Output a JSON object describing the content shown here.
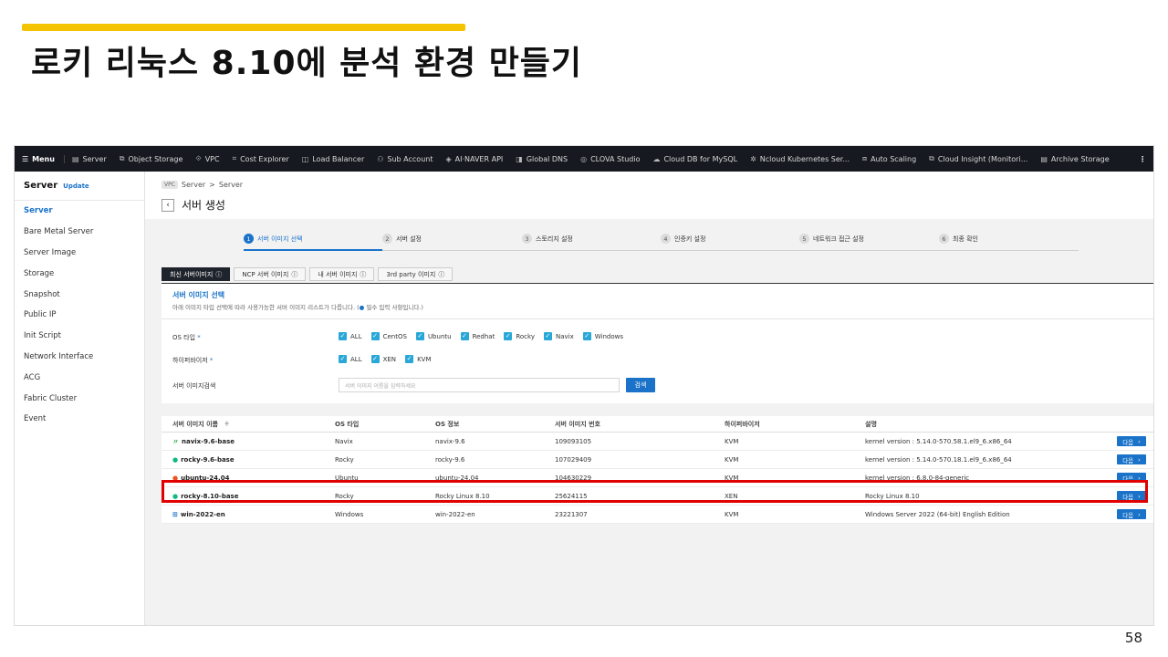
{
  "slide": {
    "title": "로키 리눅스 8.10에 분석 환경 만들기",
    "page_number": "58"
  },
  "topnav": {
    "menu_label": "Menu",
    "items": [
      {
        "label": "Server",
        "icon": "server-icon"
      },
      {
        "label": "Object Storage",
        "icon": "storage-icon"
      },
      {
        "label": "VPC",
        "icon": "vpc-icon"
      },
      {
        "label": "Cost Explorer",
        "icon": "cost-icon"
      },
      {
        "label": "Load Balancer",
        "icon": "balancer-icon"
      },
      {
        "label": "Sub Account",
        "icon": "account-icon"
      },
      {
        "label": "AI·NAVER API",
        "icon": "api-icon"
      },
      {
        "label": "Global DNS",
        "icon": "dns-icon"
      },
      {
        "label": "CLOVA Studio",
        "icon": "clova-icon"
      },
      {
        "label": "Cloud DB for MySQL",
        "icon": "db-icon"
      },
      {
        "label": "Ncloud Kubernetes Ser...",
        "icon": "kubernetes-icon"
      },
      {
        "label": "Auto Scaling",
        "icon": "scaling-icon"
      },
      {
        "label": "Cloud Insight (Monitori...",
        "icon": "insight-icon"
      },
      {
        "label": "Archive Storage",
        "icon": "archive-icon"
      }
    ],
    "more": "⋮"
  },
  "sidebar": {
    "title": "Server",
    "badge": "Update",
    "items": [
      {
        "label": "Server"
      },
      {
        "label": "Bare Metal Server"
      },
      {
        "label": "Server Image"
      },
      {
        "label": "Storage"
      },
      {
        "label": "Snapshot"
      },
      {
        "label": "Public IP"
      },
      {
        "label": "Init Script"
      },
      {
        "label": "Network Interface"
      },
      {
        "label": "ACG"
      },
      {
        "label": "Fabric Cluster"
      },
      {
        "label": "Event"
      }
    ]
  },
  "breadcrumb": {
    "vpc": "VPC",
    "part1": "Server",
    "sep": ">",
    "part2": "Server"
  },
  "page_title": "서버 생성",
  "steps": [
    {
      "num": "1",
      "label": "서버 이미지 선택"
    },
    {
      "num": "2",
      "label": "서버 설정"
    },
    {
      "num": "3",
      "label": "스토리지 설정"
    },
    {
      "num": "4",
      "label": "인증키 설정"
    },
    {
      "num": "5",
      "label": "네트워크 접근 설정"
    },
    {
      "num": "6",
      "label": "최종 확인"
    }
  ],
  "tabs": [
    {
      "label": "최신 서버이미지"
    },
    {
      "label": "NCP 서버 이미지"
    },
    {
      "label": "내 서버 이미지"
    },
    {
      "label": "3rd party 이미지"
    }
  ],
  "panel": {
    "heading": "서버 이미지 선택",
    "desc_prefix": "아래 이미지 타입 선택에 따라 사용가능한 서버 이미지 리스트가 다릅니다. (",
    "desc_req": "●",
    "desc_suffix": " 필수 입력 사항입니다.)",
    "os_label": "OS 타입",
    "os_options": [
      "ALL",
      "CentOS",
      "Ubuntu",
      "Redhat",
      "Rocky",
      "Navix",
      "Windows"
    ],
    "hv_label": "하이퍼바이저",
    "hv_options": [
      "ALL",
      "XEN",
      "KVM"
    ],
    "search_label": "서버 이미지검색",
    "search_placeholder": "서버 이미지 이름을 입력하세요",
    "search_button": "검색"
  },
  "table": {
    "headers": [
      "서버 이미지 이름",
      "OS 타입",
      "OS 정보",
      "서버 이미지 번호",
      "하이퍼바이저",
      "설명"
    ],
    "sort_icon": "≑",
    "rows": [
      {
        "name": "navix-9.6-base",
        "os_type": "Navix",
        "os_info": "navix-9.6",
        "image_no": "109093105",
        "hypervisor": "KVM",
        "desc": "kernel version : 5.14.0-570.58.1.el9_6.x86_64",
        "icon": "navix-icon",
        "icon_char": "〃",
        "icon_color": "#2aa84a"
      },
      {
        "name": "rocky-9.6-base",
        "os_type": "Rocky",
        "os_info": "rocky-9.6",
        "image_no": "107029409",
        "hypervisor": "KVM",
        "desc": "kernel version : 5.14.0-570.18.1.el9_6.x86_64",
        "icon": "rocky-icon",
        "icon_char": "●",
        "icon_color": "#10b981"
      },
      {
        "name": "ubuntu-24.04",
        "os_type": "Ubuntu",
        "os_info": "ubuntu-24.04",
        "image_no": "104630229",
        "hypervisor": "KVM",
        "desc": "kernel version : 6.8.0-84-generic",
        "icon": "ubuntu-icon",
        "icon_char": "●",
        "icon_color": "#e95420"
      },
      {
        "name": "rocky-8.10-base",
        "os_type": "Rocky",
        "os_info": "Rocky Linux 8.10",
        "image_no": "25624115",
        "hypervisor": "XEN",
        "desc": "Rocky Linux 8.10",
        "icon": "rocky-icon",
        "icon_char": "●",
        "icon_color": "#10b981"
      },
      {
        "name": "win-2022-en",
        "os_type": "Windows",
        "os_info": "win-2022-en",
        "image_no": "23221307",
        "hypervisor": "KVM",
        "desc": "Windows Server 2022 (64-bit) English Edition",
        "icon": "windows-icon",
        "icon_char": "⊞",
        "icon_color": "#1a73c9"
      }
    ],
    "next_label": "다음",
    "next_arrow": "›"
  },
  "colors": {
    "accent": "#1a73c9",
    "highlight": "#e00000",
    "title_bar": "#f5c400"
  }
}
